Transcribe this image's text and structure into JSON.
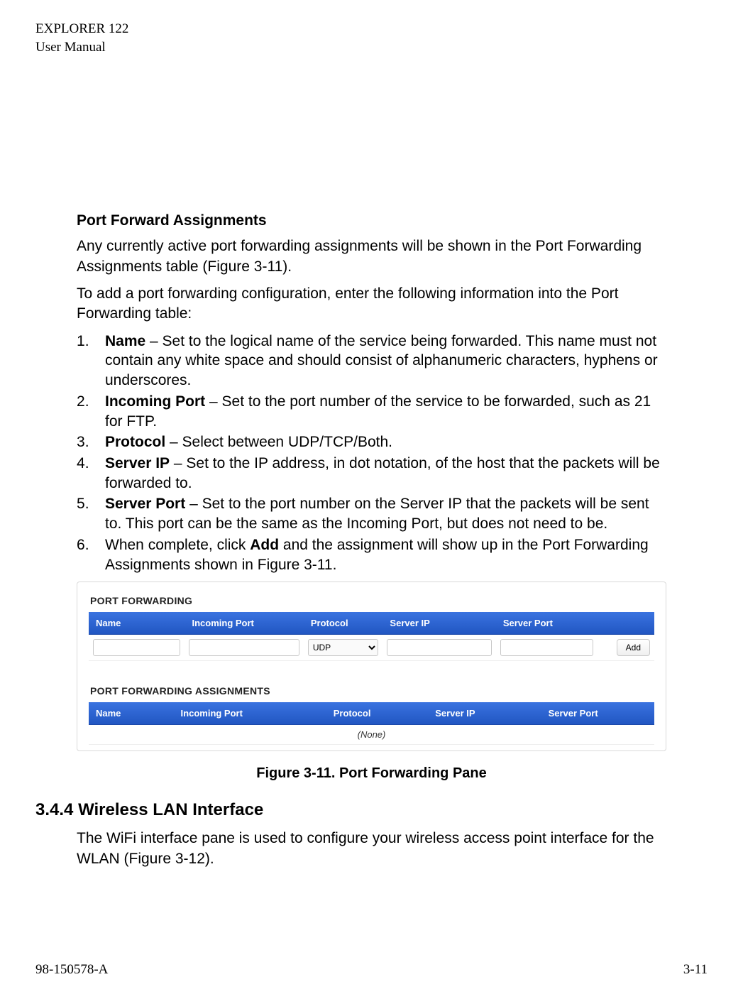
{
  "header": {
    "product": "EXPLORER 122",
    "doctype": "User Manual"
  },
  "section": {
    "heading": "Port Forward Assignments",
    "p1": "Any currently active port forwarding assignments will be shown in the Port Forwarding Assignments table (Figure 3-11).",
    "p2": "To add a port forwarding configuration, enter the following information into the Port Forwarding table:",
    "items": [
      {
        "bold": "Name",
        "rest": " – Set to the logical name of the service being forwarded.  This name must not contain any white space and should consist of alphanumeric characters, hyphens or underscores."
      },
      {
        "bold": "Incoming Port",
        "rest": " – Set to the port number of the service to be forwarded, such as 21 for FTP."
      },
      {
        "bold": "Protocol",
        "rest": " – Select between UDP/TCP/Both."
      },
      {
        "bold": "Server IP",
        "rest": " – Set to the IP address, in dot notation, of the host that the packets will be forwarded to."
      },
      {
        "bold": "Server Port",
        "rest": " – Set to the port number on the Server IP that the packets will be sent to.  This port can be the same as the Incoming Port, but does not need to be."
      },
      {
        "bold_prefix": "When complete, click ",
        "bold": "Add",
        "rest": " and the assignment will show up in the Port Forwarding Assignments shown in Figure 3-11."
      }
    ]
  },
  "figure": {
    "panel1_title": "PORT FORWARDING",
    "panel2_title": "PORT FORWARDING ASSIGNMENTS",
    "columns": [
      "Name",
      "Incoming Port",
      "Protocol",
      "Server IP",
      "Server Port",
      ""
    ],
    "protocol_value": "UDP",
    "add_label": "Add",
    "none_label": "(None)",
    "caption": "Figure 3-11. Port Forwarding Pane"
  },
  "section344": {
    "number": "3.4.4",
    "title": "Wireless LAN Interface",
    "p": "The WiFi interface pane is used to configure your wireless access point interface for the WLAN (Figure 3-12)."
  },
  "footer": {
    "left": "98-150578-A",
    "right": "3-11"
  }
}
